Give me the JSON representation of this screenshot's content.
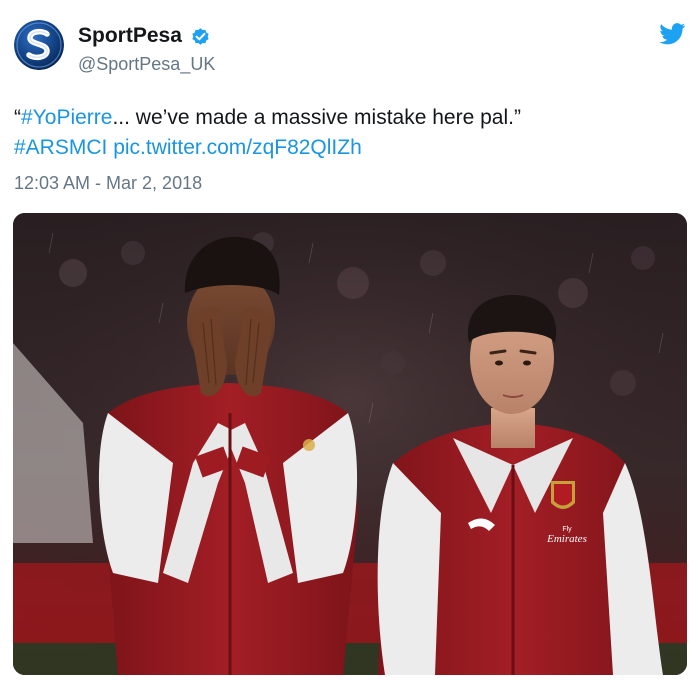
{
  "tweet": {
    "author": {
      "name": "SportPesa",
      "handle": "@SportPesa_UK",
      "verified": true,
      "avatar_icon": "sportpesa-logo"
    },
    "text": {
      "quote_open": "“",
      "hashtag_1": "#YoPierre",
      "body": "... we’ve made a massive mistake here pal.”",
      "hashtag_2": "#ARSMCI",
      "link": "pic.twitter.com/zqF82QlIZh"
    },
    "timestamp": "12:03 AM - Mar 2, 2018",
    "media": {
      "type": "photo",
      "kit_brand": "Emirates",
      "kit_sponsor_line": "Fly"
    }
  },
  "colors": {
    "link": "#1b95e0",
    "secondary_text": "#657786",
    "primary_text": "#14171a",
    "verified": "#1da1f2",
    "twitter_brand": "#1da1f2",
    "kit_red": "#9e1b22",
    "kit_white": "#f2f2f2"
  },
  "icons": {
    "verified": "verified-badge-icon",
    "platform": "twitter-bird-icon"
  }
}
